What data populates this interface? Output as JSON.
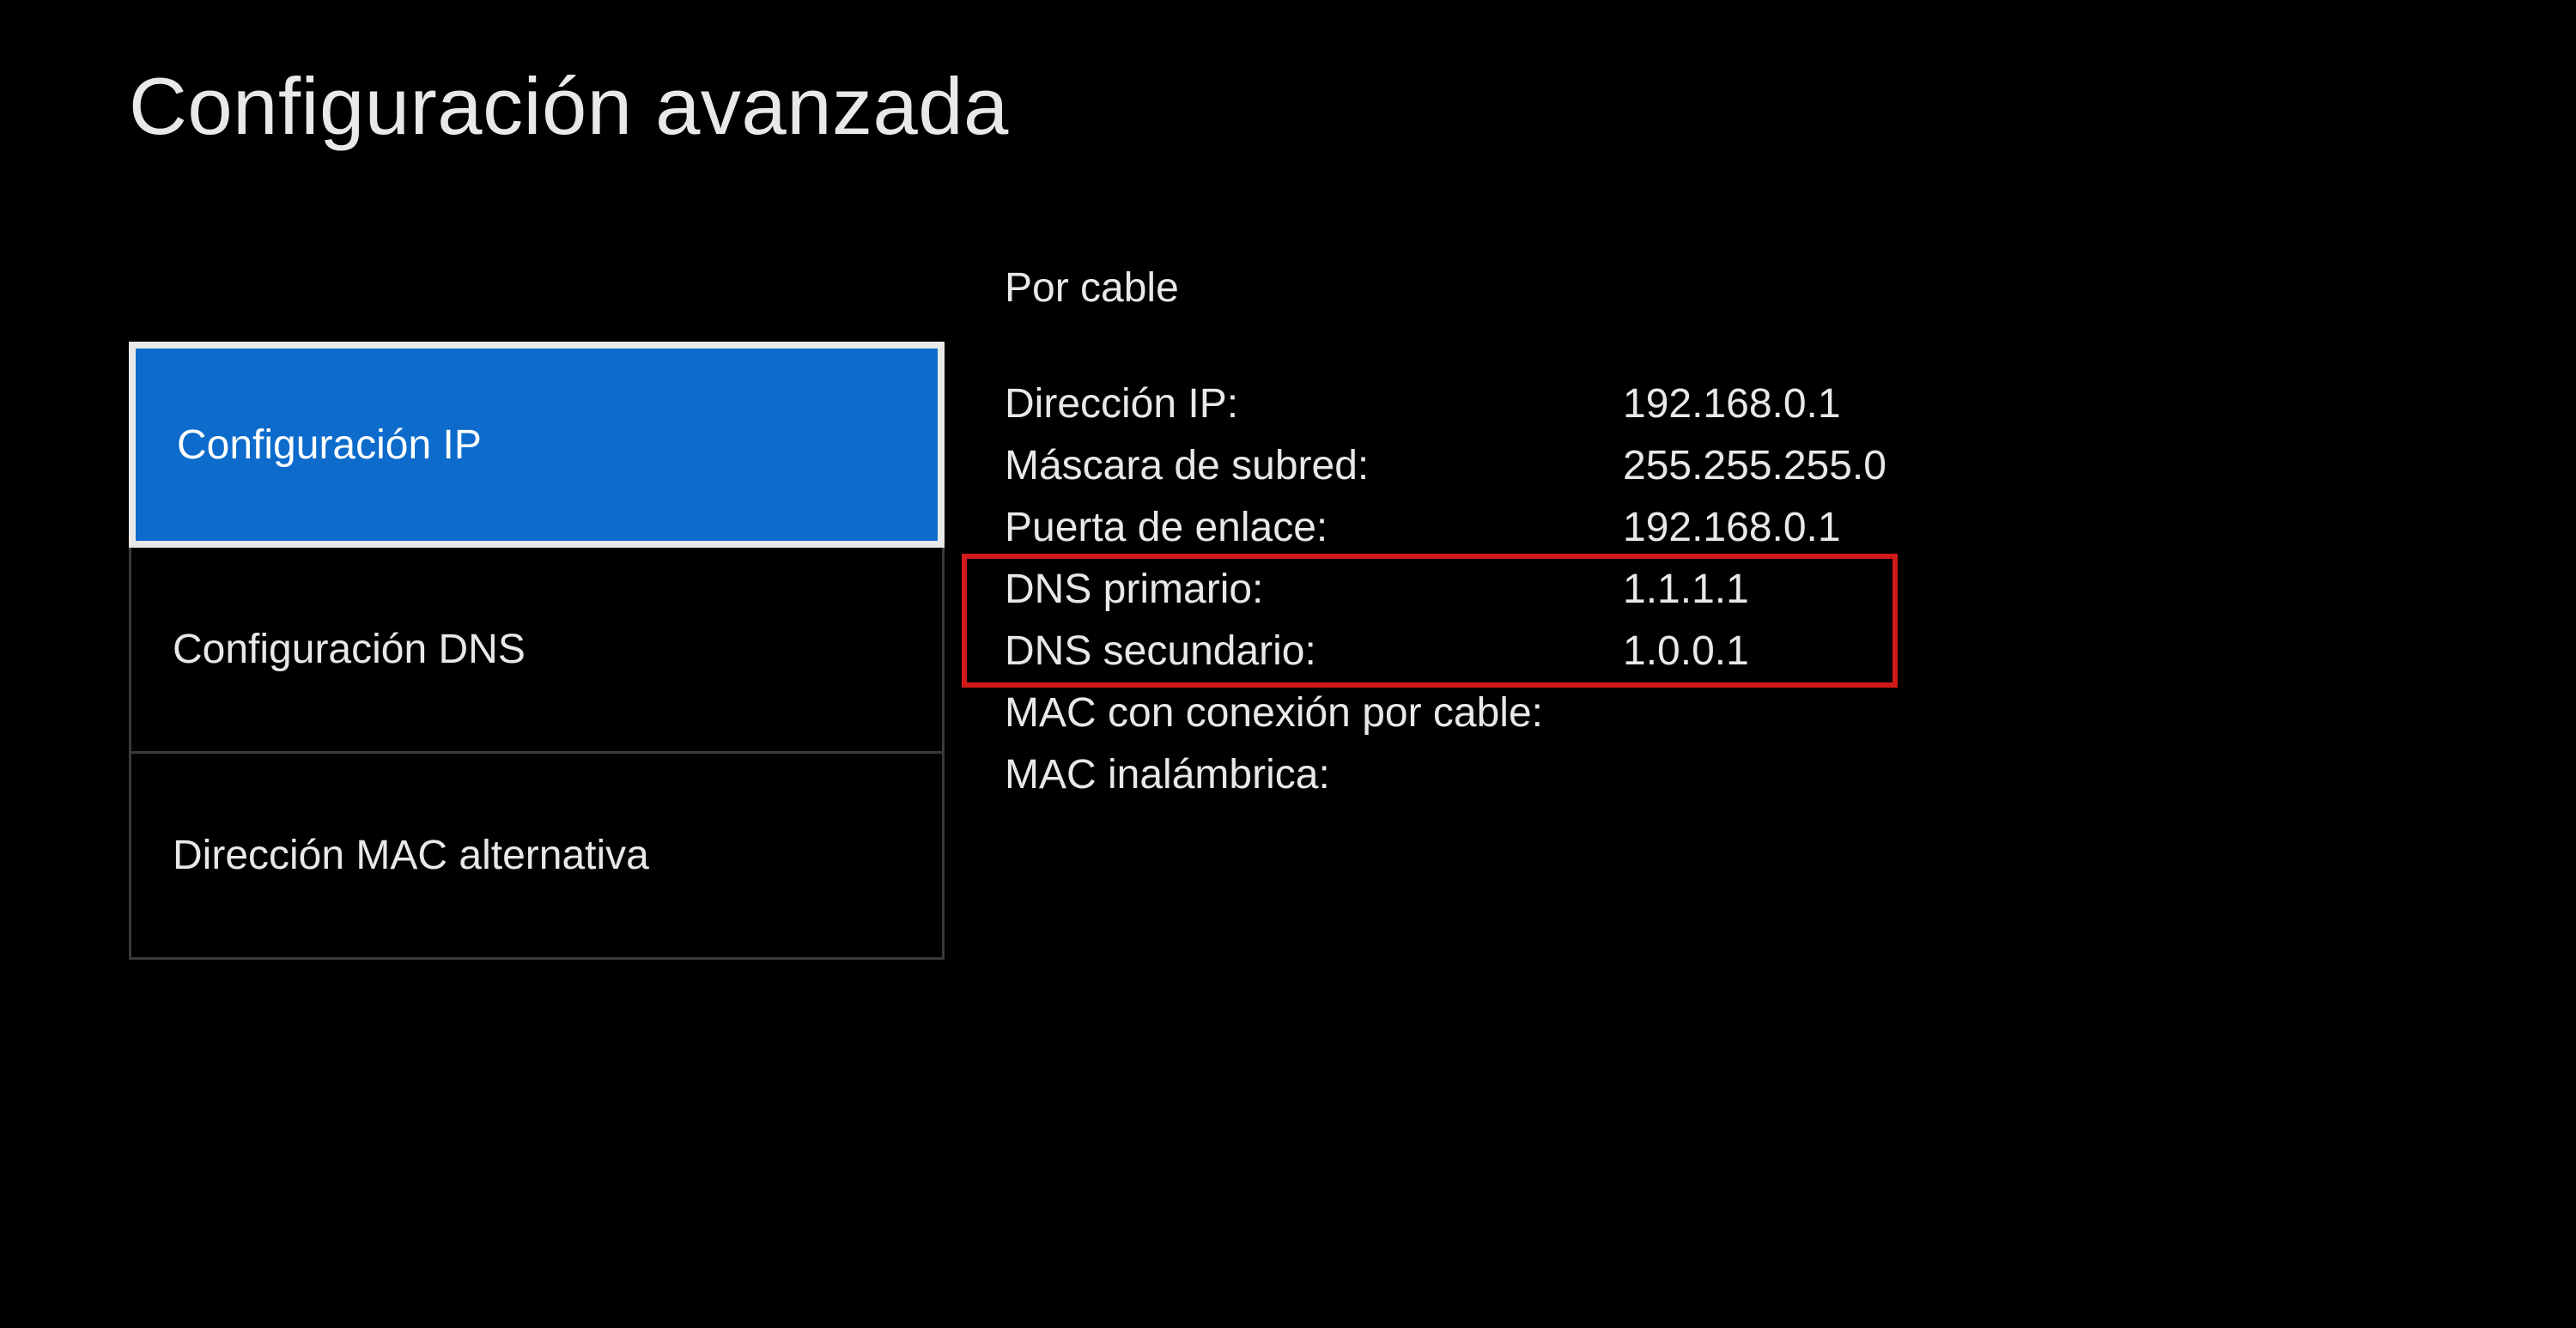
{
  "title": "Configuración avanzada",
  "menu": {
    "items": [
      {
        "label": "Configuración IP"
      },
      {
        "label": "Configuración DNS"
      },
      {
        "label": "Dirección MAC alternativa"
      }
    ],
    "selected_index": 0
  },
  "info": {
    "section_header": "Por cable",
    "rows": [
      {
        "key": "Dirección IP:",
        "value": "192.168.0.1"
      },
      {
        "key": "Máscara de subred:",
        "value": "255.255.255.0"
      },
      {
        "key": "Puerta de enlace:",
        "value": "192.168.0.1"
      }
    ],
    "dns_rows": [
      {
        "key": "DNS primario:",
        "value": "1.1.1.1"
      },
      {
        "key": "DNS secundario:",
        "value": "1.0.0.1"
      }
    ],
    "mac_rows": [
      {
        "key": "MAC con conexión por cable:",
        "value": ""
      },
      {
        "key": "MAC inalámbrica:",
        "value": ""
      }
    ]
  }
}
